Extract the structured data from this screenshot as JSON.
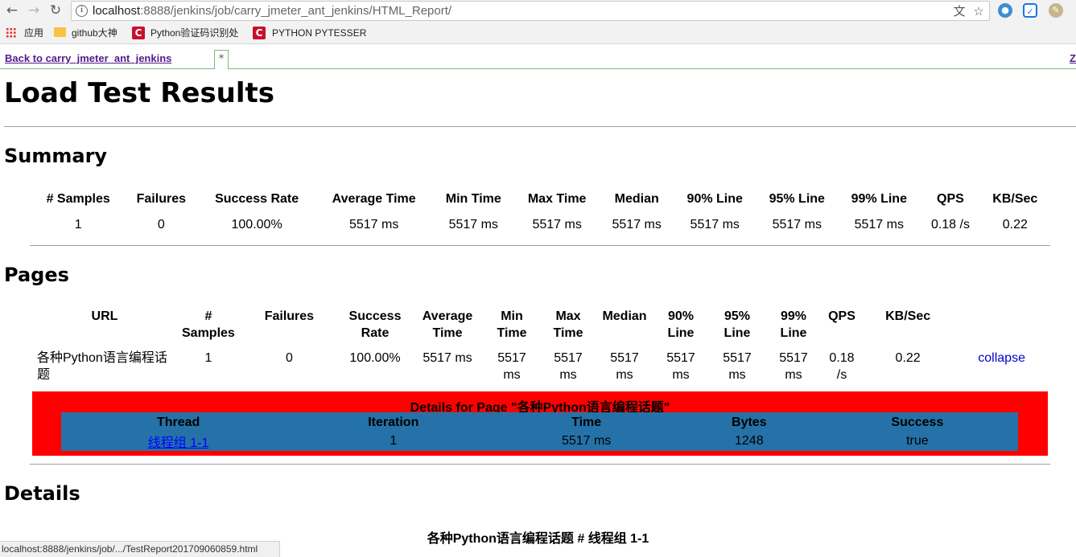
{
  "browser": {
    "url_host": "localhost",
    "url_rest": ":8888/jenkins/job/carry_jmeter_ant_jenkins/HTML_Report/",
    "bookmarks": {
      "apps": "应用",
      "github": "github大神",
      "python_captcha": "Python验证码识别处",
      "pytesser": "PYTHON PYTESSER"
    },
    "status_url": "localhost:8888/jenkins/job/.../TestReport201709060859.html",
    "colors": {
      "bookmark_c": "#c8102e",
      "folder": "#f6c344"
    }
  },
  "jenkins": {
    "back_link": "Back to carry_jmeter_ant_jenkins",
    "tab_label": "*",
    "right_link": "Z"
  },
  "report": {
    "title": "Load Test Results",
    "summary_heading": "Summary",
    "summary_headers": [
      "# Samples",
      "Failures",
      "Success Rate",
      "Average Time",
      "Min Time",
      "Max Time",
      "Median",
      "90% Line",
      "95% Line",
      "99% Line",
      "QPS",
      "KB/Sec"
    ],
    "summary_row": [
      "1",
      "0",
      "100.00%",
      "5517 ms",
      "5517 ms",
      "5517 ms",
      "5517 ms",
      "5517 ms",
      "5517 ms",
      "5517 ms",
      "0.18 /s",
      "0.22"
    ],
    "pages_heading": "Pages",
    "pages_headers": [
      "URL",
      "# Samples",
      "Failures",
      "Success Rate",
      "Average Time",
      "Min Time",
      "Max Time",
      "Median",
      "90% Line",
      "95% Line",
      "99% Line",
      "QPS",
      "KB/Sec",
      ""
    ],
    "pages_row": {
      "url": "各种Python语言编程话题",
      "samples": "1",
      "failures": "0",
      "success_rate": "100.00%",
      "average": "5517 ms",
      "min": "5517 ms",
      "max": "5517 ms",
      "median": "5517 ms",
      "line90": "5517 ms",
      "line95": "5517 ms",
      "line99": "5517 ms",
      "qps": "0.18 /s",
      "kbsec": "0.22",
      "action": "collapse"
    },
    "page_details": {
      "title": "Details for Page \"各种Python语言编程话题\"",
      "headers": [
        "Thread",
        "Iteration",
        "Time",
        "Bytes",
        "Success"
      ],
      "row": [
        "线程组 1-1",
        "1",
        "5517 ms",
        "1248",
        "true"
      ],
      "colors": {
        "box": "#ff0000",
        "table": "#2572a8"
      }
    },
    "details_heading": "Details",
    "details_subheading": "各种Python语言编程话题 # 线程组 1-1"
  }
}
